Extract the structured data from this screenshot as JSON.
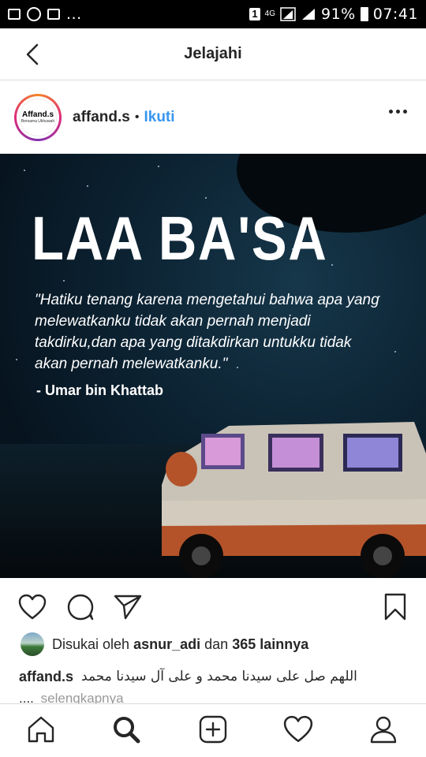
{
  "status_bar": {
    "notification_count": "...",
    "badge": "1",
    "network": "4G",
    "battery": "91%",
    "time": "07:41"
  },
  "header": {
    "title": "Jelajahi",
    "back_icon": "chevron-left-icon"
  },
  "post": {
    "avatar_text": "Affand.s",
    "avatar_subtext": "Bersama Ukhuwah",
    "username": "affand.s",
    "separator": "•",
    "follow_label": "Ikuti",
    "more_icon": "more-horizontal-icon",
    "image": {
      "headline": "LAA BA'SA",
      "quote": "\"Hatiku tenang karena mengetahui bahwa apa yang melewatkanku tidak akan pernah menjadi takdirku,dan apa yang ditakdirkan untukku tidak akan pernah melewatkanku.\"",
      "author": "- Umar bin Khattab"
    },
    "actions": {
      "like_icon": "heart-icon",
      "comment_icon": "comment-icon",
      "share_icon": "send-icon",
      "save_icon": "bookmark-icon"
    },
    "likes": {
      "prefix": "Disukai oleh",
      "user": "asnur_adi",
      "middle": "dan",
      "others": "365 lainnya"
    },
    "caption": {
      "user": "affand.s",
      "text": "اللهم صل على سيدنا محمد و على آل سيدنا محمد",
      "ellipsis": "....",
      "more": "selengkapnya"
    }
  },
  "bottom_nav": {
    "items": [
      "home-icon",
      "search-icon",
      "add-post-icon",
      "activity-heart-icon",
      "profile-icon"
    ]
  },
  "colors": {
    "link_blue": "#3897f0",
    "text_dark": "#262626",
    "muted": "#999999",
    "divider": "#dbdbdb"
  }
}
